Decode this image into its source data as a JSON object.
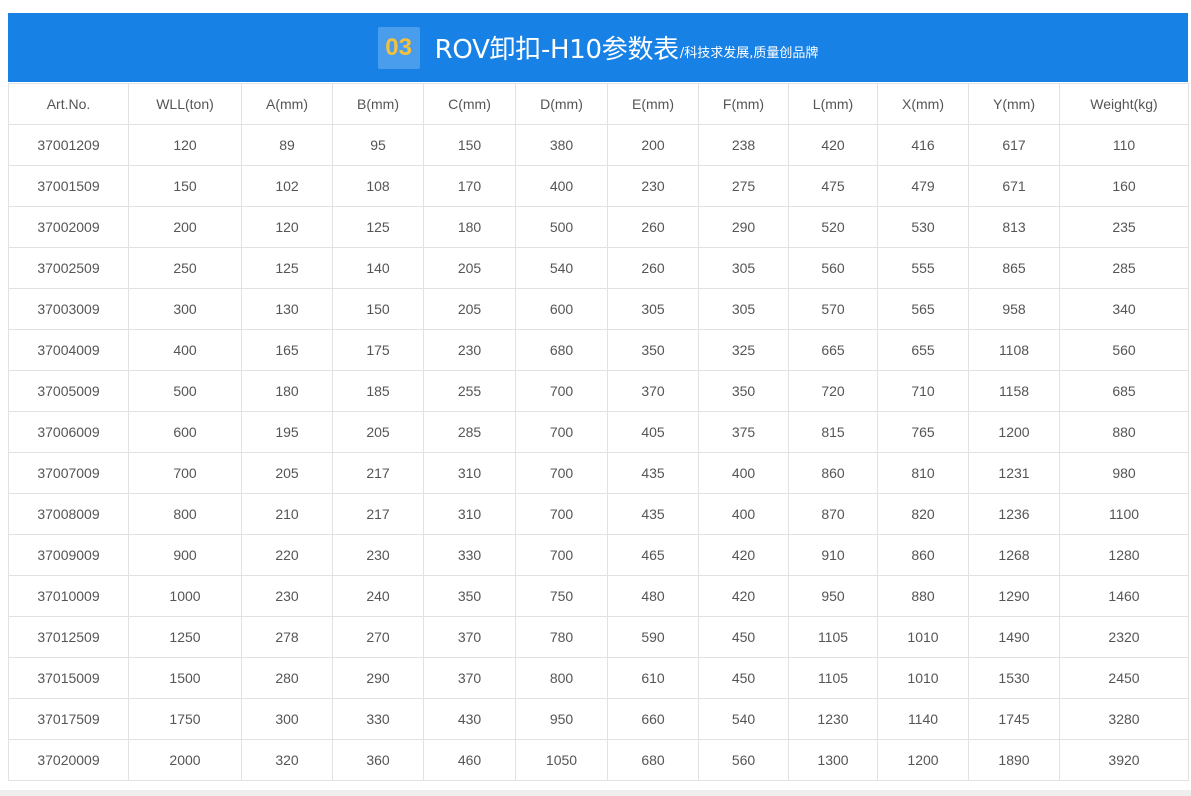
{
  "banner": {
    "number": "03",
    "title": "ROV卸扣-H10参数表",
    "subtitle": "/科技求发展,质量创品牌",
    "bg_color": "#1781e6",
    "number_color": "#f5c13b"
  },
  "table": {
    "headers": [
      "Art.No.",
      "WLL(ton)",
      "A(mm)",
      "B(mm)",
      "C(mm)",
      "D(mm)",
      "E(mm)",
      "F(mm)",
      "L(mm)",
      "X(mm)",
      "Y(mm)",
      "Weight(kg)"
    ],
    "rows": [
      [
        "37001209",
        "120",
        "89",
        "95",
        "150",
        "380",
        "200",
        "238",
        "420",
        "416",
        "617",
        "110"
      ],
      [
        "37001509",
        "150",
        "102",
        "108",
        "170",
        "400",
        "230",
        "275",
        "475",
        "479",
        "671",
        "160"
      ],
      [
        "37002009",
        "200",
        "120",
        "125",
        "180",
        "500",
        "260",
        "290",
        "520",
        "530",
        "813",
        "235"
      ],
      [
        "37002509",
        "250",
        "125",
        "140",
        "205",
        "540",
        "260",
        "305",
        "560",
        "555",
        "865",
        "285"
      ],
      [
        "37003009",
        "300",
        "130",
        "150",
        "205",
        "600",
        "305",
        "305",
        "570",
        "565",
        "958",
        "340"
      ],
      [
        "37004009",
        "400",
        "165",
        "175",
        "230",
        "680",
        "350",
        "325",
        "665",
        "655",
        "1108",
        "560"
      ],
      [
        "37005009",
        "500",
        "180",
        "185",
        "255",
        "700",
        "370",
        "350",
        "720",
        "710",
        "1158",
        "685"
      ],
      [
        "37006009",
        "600",
        "195",
        "205",
        "285",
        "700",
        "405",
        "375",
        "815",
        "765",
        "1200",
        "880"
      ],
      [
        "37007009",
        "700",
        "205",
        "217",
        "310",
        "700",
        "435",
        "400",
        "860",
        "810",
        "1231",
        "980"
      ],
      [
        "37008009",
        "800",
        "210",
        "217",
        "310",
        "700",
        "435",
        "400",
        "870",
        "820",
        "1236",
        "1100"
      ],
      [
        "37009009",
        "900",
        "220",
        "230",
        "330",
        "700",
        "465",
        "420",
        "910",
        "860",
        "1268",
        "1280"
      ],
      [
        "37010009",
        "1000",
        "230",
        "240",
        "350",
        "750",
        "480",
        "420",
        "950",
        "880",
        "1290",
        "1460"
      ],
      [
        "37012509",
        "1250",
        "278",
        "270",
        "370",
        "780",
        "590",
        "450",
        "1105",
        "1010",
        "1490",
        "2320"
      ],
      [
        "37015009",
        "1500",
        "280",
        "290",
        "370",
        "800",
        "610",
        "450",
        "1105",
        "1010",
        "1530",
        "2450"
      ],
      [
        "37017509",
        "1750",
        "300",
        "330",
        "430",
        "950",
        "660",
        "540",
        "1230",
        "1140",
        "1745",
        "3280"
      ],
      [
        "37020009",
        "2000",
        "320",
        "360",
        "460",
        "1050",
        "680",
        "560",
        "1300",
        "1200",
        "1890",
        "3920"
      ]
    ]
  }
}
